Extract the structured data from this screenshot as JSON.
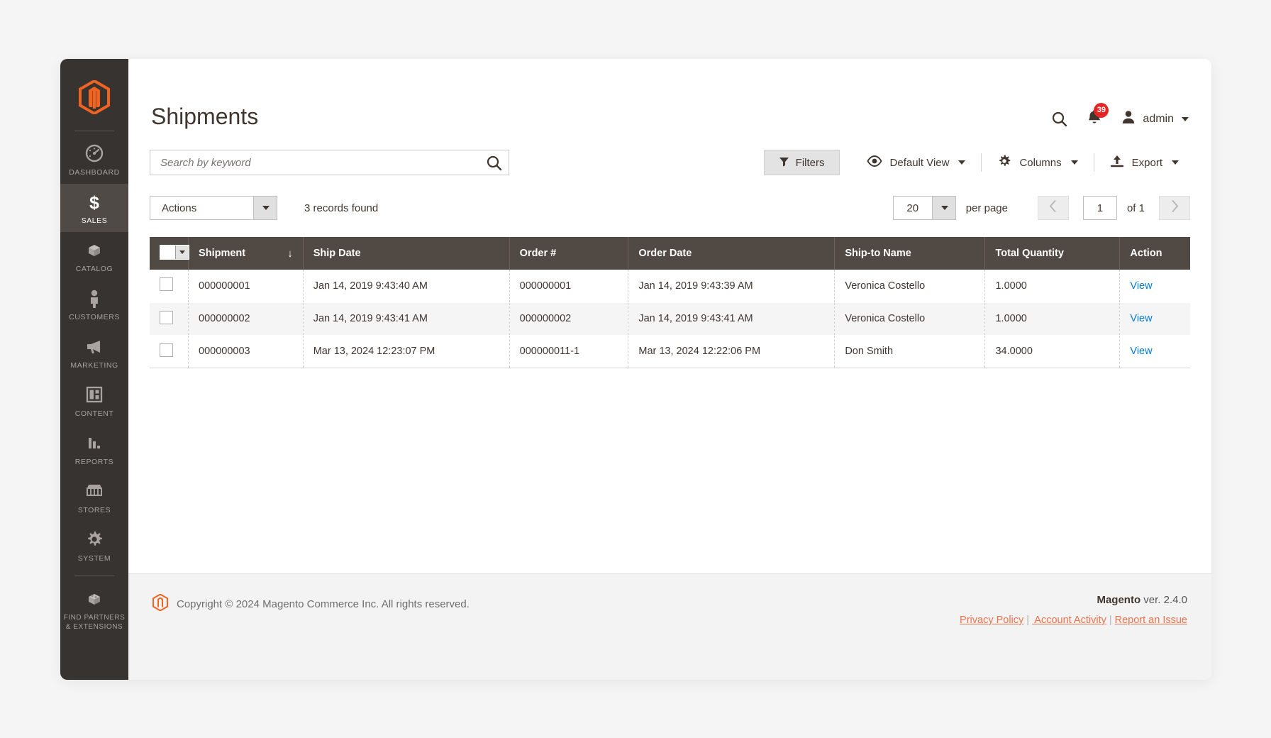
{
  "sidebar": {
    "logo_icon": "magento-logo-icon",
    "items": [
      {
        "id": "dashboard",
        "label": "DASHBOARD",
        "icon": "dashboard-gauge-icon",
        "active": false,
        "divider_above": true
      },
      {
        "id": "sales",
        "label": "SALES",
        "icon": "dollar-sign-icon",
        "active": true,
        "divider_above": false
      },
      {
        "id": "catalog",
        "label": "CATALOG",
        "icon": "boxes-icon",
        "active": false,
        "divider_above": false
      },
      {
        "id": "customers",
        "label": "CUSTOMERS",
        "icon": "person-icon",
        "active": false,
        "divider_above": false
      },
      {
        "id": "marketing",
        "label": "MARKETING",
        "icon": "megaphone-icon",
        "active": false,
        "divider_above": false
      },
      {
        "id": "content",
        "label": "CONTENT",
        "icon": "layout-panels-icon",
        "active": false,
        "divider_above": false
      },
      {
        "id": "reports",
        "label": "REPORTS",
        "icon": "bar-chart-icon",
        "active": false,
        "divider_above": false
      },
      {
        "id": "stores",
        "label": "STORES",
        "icon": "storefront-icon",
        "active": false,
        "divider_above": false
      },
      {
        "id": "system",
        "label": "SYSTEM",
        "icon": "gear-icon",
        "active": false,
        "divider_above": false
      },
      {
        "id": "find-partners",
        "label": "FIND PARTNERS\n& EXTENSIONS",
        "label_line1": "FIND PARTNERS",
        "label_line2": "& EXTENSIONS",
        "icon": "extension-block-icon",
        "active": false,
        "divider_above": true
      }
    ]
  },
  "header": {
    "title": "Shipments",
    "search_icon": "search-icon",
    "notifications_icon": "bell-icon",
    "notifications_count": "39",
    "user_icon": "user-avatar-icon",
    "user_name": "admin",
    "user_caret_icon": "chevron-down-icon"
  },
  "search": {
    "placeholder": "Search by keyword",
    "value": "",
    "submit_icon": "search-icon"
  },
  "toolbar": {
    "filters_label": "Filters",
    "filters_icon": "funnel-icon",
    "view_label": "Default View",
    "view_icon": "eye-icon",
    "columns_label": "Columns",
    "columns_icon": "gear-icon",
    "export_label": "Export",
    "export_icon": "upload-icon"
  },
  "actions_row": {
    "actions_label": "Actions",
    "actions_caret_icon": "caret-down-icon",
    "records_found": "3 records found",
    "per_page_value": "20",
    "per_page_caret_icon": "caret-down-icon",
    "per_page_label": "per page",
    "prev_icon": "chevron-left-icon",
    "next_icon": "chevron-right-icon",
    "page_value": "1",
    "page_of": "of 1"
  },
  "grid": {
    "select_all_icon": "checkbox-dropdown-icon",
    "sort_indicator": "↓",
    "columns": [
      {
        "key": "shipment",
        "label": "Shipment",
        "sorted": true
      },
      {
        "key": "ship_date",
        "label": "Ship Date",
        "sorted": false
      },
      {
        "key": "order_number",
        "label": "Order #",
        "sorted": false
      },
      {
        "key": "order_date",
        "label": "Order Date",
        "sorted": false
      },
      {
        "key": "ship_to_name",
        "label": "Ship-to Name",
        "sorted": false
      },
      {
        "key": "total_quantity",
        "label": "Total Quantity",
        "sorted": false
      },
      {
        "key": "action",
        "label": "Action",
        "sorted": false
      }
    ],
    "rows": [
      {
        "shipment": "000000001",
        "ship_date": "Jan 14, 2019 9:43:40 AM",
        "order_number": "000000001",
        "order_date": "Jan 14, 2019 9:43:39 AM",
        "ship_to_name": "Veronica Costello",
        "total_quantity": "1.0000",
        "action": "View",
        "checked": false
      },
      {
        "shipment": "000000002",
        "ship_date": "Jan 14, 2019 9:43:41 AM",
        "order_number": "000000002",
        "order_date": "Jan 14, 2019 9:43:41 AM",
        "ship_to_name": "Veronica Costello",
        "total_quantity": "1.0000",
        "action": "View",
        "checked": false
      },
      {
        "shipment": "000000003",
        "ship_date": "Mar 13, 2024 12:23:07 PM",
        "order_number": "000000011-1",
        "order_date": "Mar 13, 2024 12:22:06 PM",
        "ship_to_name": "Don Smith",
        "total_quantity": "34.0000",
        "action": "View",
        "checked": false
      }
    ]
  },
  "footer": {
    "logo_icon": "magento-logo-icon",
    "copyright": "Copyright © 2024 Magento Commerce Inc. All rights reserved.",
    "brand": "Magento",
    "version": " ver. 2.4.0",
    "links": [
      {
        "label": "Privacy Policy"
      },
      {
        "label": " Account Activity"
      },
      {
        "label": "Report an Issue"
      }
    ],
    "link_separator": "|"
  },
  "colors": {
    "sidebar_bg": "#373330",
    "sidebar_active": "#4f4a45",
    "magento_orange": "#f26322",
    "grid_header_bg": "#514943",
    "badge_red": "#e22626",
    "link_blue": "#007bdb",
    "footer_link": "#e8734e"
  }
}
